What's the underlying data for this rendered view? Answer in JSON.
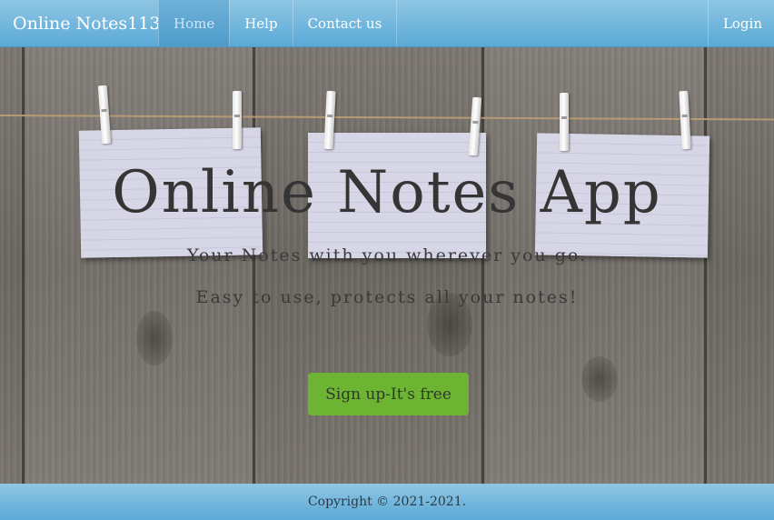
{
  "navbar": {
    "brand": "Online Notes113",
    "items": [
      {
        "label": "Home",
        "active": true
      },
      {
        "label": "Help",
        "active": false
      },
      {
        "label": "Contact us",
        "active": false
      }
    ],
    "login_label": "Login"
  },
  "hero": {
    "title": "Online Notes App",
    "subtitle_1": "Your Notes with you wherever you go.",
    "subtitle_2": "Easy to use, protects all your notes!",
    "signup_label": "Sign up-It's free"
  },
  "footer": {
    "copyright": "Copyright © 2021-2021."
  },
  "colors": {
    "nav_bg": "#6cb3dc",
    "signup_button": "#6cb432",
    "title_text": "#353535"
  }
}
